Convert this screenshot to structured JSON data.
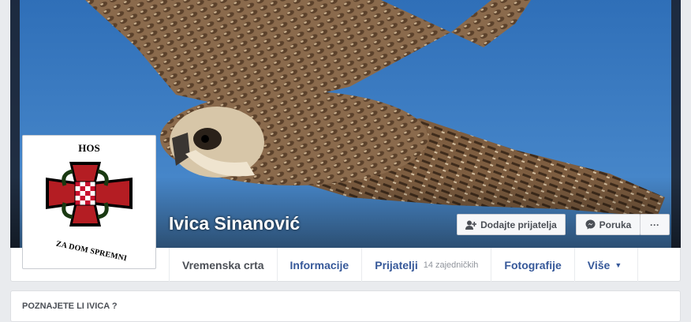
{
  "profile": {
    "name": "Ivica Sinanović"
  },
  "avatar": {
    "logo_text": "HOS",
    "motto": "ZA DOM SPREMNI"
  },
  "actions": {
    "add_friend": "Dodajte prijatelja",
    "message": "Poruka",
    "more": "···"
  },
  "nav": {
    "tabs": [
      {
        "label": "Vremenska crta"
      },
      {
        "label": "Informacije"
      },
      {
        "label": "Prijatelji",
        "count": "14 zajedničkih"
      },
      {
        "label": "Fotografije"
      },
      {
        "label": "Više"
      }
    ]
  },
  "know_box": {
    "title": "POZNAJETE LI IVICA ?"
  },
  "colors": {
    "link": "#365899",
    "sky": "#3f7fc4",
    "cross_red": "#b41d23",
    "page_bg": "#e9ebee"
  },
  "icons": {
    "add_friend": "add-friend-icon",
    "message": "messenger-icon",
    "more": "more-dots-icon",
    "dropdown": "caret-down-icon"
  }
}
